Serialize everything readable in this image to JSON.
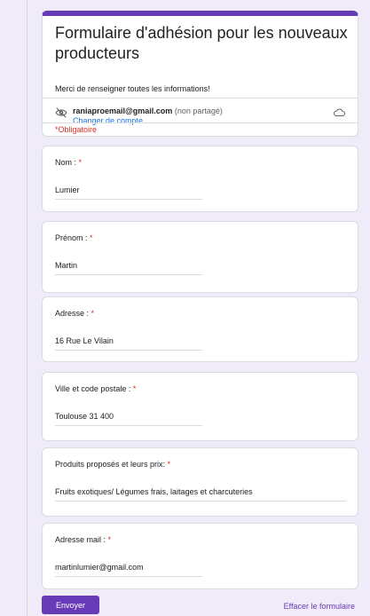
{
  "form": {
    "title": "Formulaire d'adhésion pour les nouveaux producteurs",
    "description": "Merci de renseigner toutes les informations!",
    "account_email": "raniaproemail@gmail.com",
    "account_not_shared": "(non partagé)",
    "switch_account": "Changer de compte",
    "required_note": "*Obligatoire"
  },
  "questions": [
    {
      "label": "Nom :",
      "required_mark": "*",
      "value": "Lumier"
    },
    {
      "label": "Prénom :",
      "required_mark": "*",
      "value": "Martin"
    },
    {
      "label": "Adresse :",
      "required_mark": "*",
      "value": "16 Rue Le Vilain"
    },
    {
      "label": "Ville et code postale :",
      "required_mark": "*",
      "value": "Toulouse 31 400"
    },
    {
      "label": "Produits proposés et leurs prix:",
      "required_mark": "*",
      "value": "Fruits exotiques/ Légumes frais, laitages et charcuteries"
    },
    {
      "label": "Adresse mail :",
      "required_mark": "*",
      "value": "martinlumier@gmail.com"
    }
  ],
  "actions": {
    "submit_label": "Envoyer",
    "clear_label": "Effacer le formulaire"
  },
  "colors": {
    "accent": "#673ab7",
    "required": "#d93025",
    "link": "#1a73e8",
    "background": "#f0ebf8"
  },
  "icons": {
    "visibility": "eye-off-icon",
    "cloud": "cloud-off-icon"
  }
}
